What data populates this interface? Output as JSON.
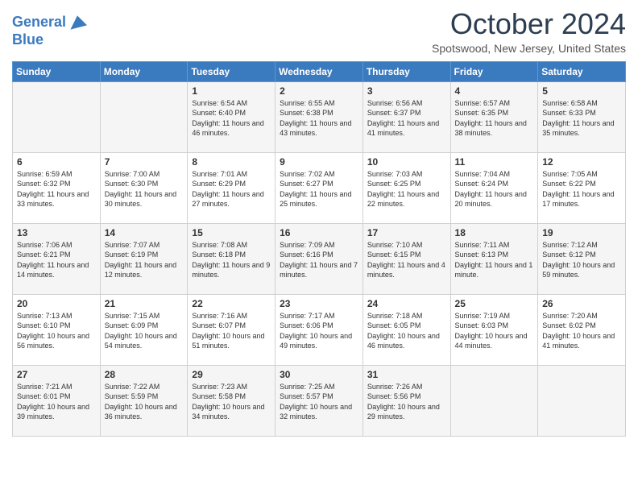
{
  "header": {
    "logo_line1": "General",
    "logo_line2": "Blue",
    "month": "October 2024",
    "location": "Spotswood, New Jersey, United States"
  },
  "days_of_week": [
    "Sunday",
    "Monday",
    "Tuesday",
    "Wednesday",
    "Thursday",
    "Friday",
    "Saturday"
  ],
  "weeks": [
    [
      {
        "day": "",
        "info": ""
      },
      {
        "day": "",
        "info": ""
      },
      {
        "day": "1",
        "info": "Sunrise: 6:54 AM\nSunset: 6:40 PM\nDaylight: 11 hours and 46 minutes."
      },
      {
        "day": "2",
        "info": "Sunrise: 6:55 AM\nSunset: 6:38 PM\nDaylight: 11 hours and 43 minutes."
      },
      {
        "day": "3",
        "info": "Sunrise: 6:56 AM\nSunset: 6:37 PM\nDaylight: 11 hours and 41 minutes."
      },
      {
        "day": "4",
        "info": "Sunrise: 6:57 AM\nSunset: 6:35 PM\nDaylight: 11 hours and 38 minutes."
      },
      {
        "day": "5",
        "info": "Sunrise: 6:58 AM\nSunset: 6:33 PM\nDaylight: 11 hours and 35 minutes."
      }
    ],
    [
      {
        "day": "6",
        "info": "Sunrise: 6:59 AM\nSunset: 6:32 PM\nDaylight: 11 hours and 33 minutes."
      },
      {
        "day": "7",
        "info": "Sunrise: 7:00 AM\nSunset: 6:30 PM\nDaylight: 11 hours and 30 minutes."
      },
      {
        "day": "8",
        "info": "Sunrise: 7:01 AM\nSunset: 6:29 PM\nDaylight: 11 hours and 27 minutes."
      },
      {
        "day": "9",
        "info": "Sunrise: 7:02 AM\nSunset: 6:27 PM\nDaylight: 11 hours and 25 minutes."
      },
      {
        "day": "10",
        "info": "Sunrise: 7:03 AM\nSunset: 6:25 PM\nDaylight: 11 hours and 22 minutes."
      },
      {
        "day": "11",
        "info": "Sunrise: 7:04 AM\nSunset: 6:24 PM\nDaylight: 11 hours and 20 minutes."
      },
      {
        "day": "12",
        "info": "Sunrise: 7:05 AM\nSunset: 6:22 PM\nDaylight: 11 hours and 17 minutes."
      }
    ],
    [
      {
        "day": "13",
        "info": "Sunrise: 7:06 AM\nSunset: 6:21 PM\nDaylight: 11 hours and 14 minutes."
      },
      {
        "day": "14",
        "info": "Sunrise: 7:07 AM\nSunset: 6:19 PM\nDaylight: 11 hours and 12 minutes."
      },
      {
        "day": "15",
        "info": "Sunrise: 7:08 AM\nSunset: 6:18 PM\nDaylight: 11 hours and 9 minutes."
      },
      {
        "day": "16",
        "info": "Sunrise: 7:09 AM\nSunset: 6:16 PM\nDaylight: 11 hours and 7 minutes."
      },
      {
        "day": "17",
        "info": "Sunrise: 7:10 AM\nSunset: 6:15 PM\nDaylight: 11 hours and 4 minutes."
      },
      {
        "day": "18",
        "info": "Sunrise: 7:11 AM\nSunset: 6:13 PM\nDaylight: 11 hours and 1 minute."
      },
      {
        "day": "19",
        "info": "Sunrise: 7:12 AM\nSunset: 6:12 PM\nDaylight: 10 hours and 59 minutes."
      }
    ],
    [
      {
        "day": "20",
        "info": "Sunrise: 7:13 AM\nSunset: 6:10 PM\nDaylight: 10 hours and 56 minutes."
      },
      {
        "day": "21",
        "info": "Sunrise: 7:15 AM\nSunset: 6:09 PM\nDaylight: 10 hours and 54 minutes."
      },
      {
        "day": "22",
        "info": "Sunrise: 7:16 AM\nSunset: 6:07 PM\nDaylight: 10 hours and 51 minutes."
      },
      {
        "day": "23",
        "info": "Sunrise: 7:17 AM\nSunset: 6:06 PM\nDaylight: 10 hours and 49 minutes."
      },
      {
        "day": "24",
        "info": "Sunrise: 7:18 AM\nSunset: 6:05 PM\nDaylight: 10 hours and 46 minutes."
      },
      {
        "day": "25",
        "info": "Sunrise: 7:19 AM\nSunset: 6:03 PM\nDaylight: 10 hours and 44 minutes."
      },
      {
        "day": "26",
        "info": "Sunrise: 7:20 AM\nSunset: 6:02 PM\nDaylight: 10 hours and 41 minutes."
      }
    ],
    [
      {
        "day": "27",
        "info": "Sunrise: 7:21 AM\nSunset: 6:01 PM\nDaylight: 10 hours and 39 minutes."
      },
      {
        "day": "28",
        "info": "Sunrise: 7:22 AM\nSunset: 5:59 PM\nDaylight: 10 hours and 36 minutes."
      },
      {
        "day": "29",
        "info": "Sunrise: 7:23 AM\nSunset: 5:58 PM\nDaylight: 10 hours and 34 minutes."
      },
      {
        "day": "30",
        "info": "Sunrise: 7:25 AM\nSunset: 5:57 PM\nDaylight: 10 hours and 32 minutes."
      },
      {
        "day": "31",
        "info": "Sunrise: 7:26 AM\nSunset: 5:56 PM\nDaylight: 10 hours and 29 minutes."
      },
      {
        "day": "",
        "info": ""
      },
      {
        "day": "",
        "info": ""
      }
    ]
  ]
}
